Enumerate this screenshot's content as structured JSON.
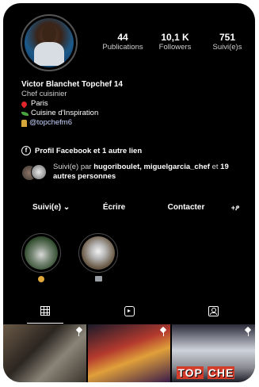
{
  "profile": {
    "stats": [
      {
        "value": "44",
        "label": "Publications"
      },
      {
        "value": "10,1 K",
        "label": "Followers"
      },
      {
        "value": "751",
        "label": "Suivi(e)s"
      }
    ],
    "name": "Victor Blanchet Topchef 14",
    "category": "Chef cuisinier",
    "bio_lines": [
      "Paris",
      "Cuisine d'Inspiration",
      "@topchefm6"
    ],
    "link_text": "Profil Facebook et 1 autre lien",
    "followed_by_prefix": "Suivi(e) par ",
    "followed_by_users": "hugoriboulet, miguelgarcia_chef",
    "followed_by_middle": " et ",
    "followed_by_others": "19 autres personnes"
  },
  "actions": {
    "follow_label": "Suivi(e) ⌄",
    "message_label": "Écrire",
    "contact_label": "Contacter",
    "add_label": "+ዖ"
  },
  "highlights": [
    {
      "icon": "cook-emoji-icon"
    },
    {
      "icon": "tv-emoji-icon"
    }
  ],
  "tabs": [
    {
      "icon": "grid-icon",
      "active": true
    },
    {
      "icon": "reels-icon",
      "active": false
    },
    {
      "icon": "tagged-icon",
      "active": false
    }
  ],
  "posts": {
    "logo_text_1": "TOP",
    "logo_text_2": "CHE"
  }
}
